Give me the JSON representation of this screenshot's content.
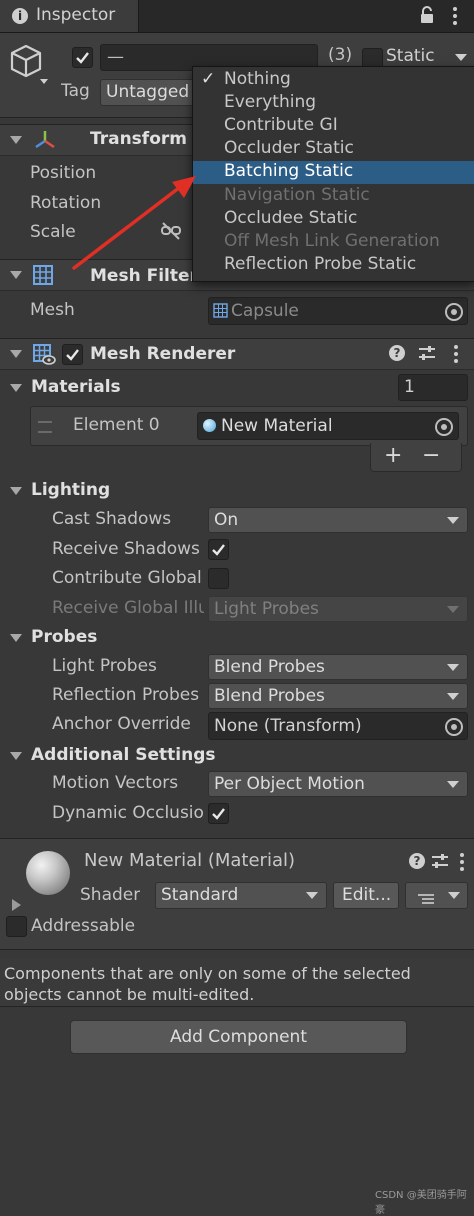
{
  "tab": {
    "title": "Inspector"
  },
  "header": {
    "name_value": "—",
    "count": "(3)",
    "static_label": "Static",
    "tag_label": "Tag",
    "tag_value": "Untagged"
  },
  "static_menu": {
    "items": [
      {
        "label": "Nothing",
        "checked": true,
        "state": "normal"
      },
      {
        "label": "Everything",
        "state": "normal"
      },
      {
        "label": "Contribute GI",
        "state": "normal"
      },
      {
        "label": "Occluder Static",
        "state": "normal"
      },
      {
        "label": "Batching Static",
        "state": "selected"
      },
      {
        "label": "Navigation Static",
        "state": "disabled"
      },
      {
        "label": "Occludee Static",
        "state": "normal"
      },
      {
        "label": "Off Mesh Link Generation",
        "state": "disabled"
      },
      {
        "label": "Reflection Probe Static",
        "state": "normal"
      }
    ],
    "check_glyph": "✓"
  },
  "transform": {
    "title": "Transform",
    "position_label": "Position",
    "rotation_label": "Rotation",
    "scale_label": "Scale"
  },
  "mesh_filter": {
    "title": "Mesh Filter",
    "mesh_label": "Mesh",
    "mesh_value": "Capsule"
  },
  "mesh_renderer": {
    "title": "Mesh Renderer",
    "materials_label": "Materials",
    "materials_count": "1",
    "element_label": "Element 0",
    "element_value": "New Material",
    "plus": "+",
    "minus": "−",
    "lighting_label": "Lighting",
    "cast_shadows_label": "Cast Shadows",
    "cast_shadows_value": "On",
    "receive_shadows_label": "Receive Shadows",
    "contribute_global_label": "Contribute Global",
    "receive_gi_label": "Receive Global Illu",
    "receive_gi_value": "Light Probes",
    "probes_label": "Probes",
    "light_probes_label": "Light Probes",
    "light_probes_value": "Blend Probes",
    "reflection_probes_label": "Reflection Probes",
    "reflection_probes_value": "Blend Probes",
    "anchor_override_label": "Anchor Override",
    "anchor_override_value": "None (Transform)",
    "additional_label": "Additional Settings",
    "motion_vectors_label": "Motion Vectors",
    "motion_vectors_value": "Per Object Motion",
    "dynamic_occlusion_label": "Dynamic Occlusion"
  },
  "material": {
    "title": "New Material (Material)",
    "shader_label": "Shader",
    "shader_value": "Standard",
    "edit_label": "Edit...",
    "addressable_label": "Addressable"
  },
  "notice": {
    "text": "Components that are only on some of the selected objects cannot be multi-edited."
  },
  "add_component": {
    "label": "Add Component"
  },
  "watermark": {
    "text": "CSDN @美团骑手阿豪"
  },
  "colors": {
    "background": "#383838",
    "menu_highlight": "#2c5d87",
    "annotation_arrow": "#e02f24"
  }
}
